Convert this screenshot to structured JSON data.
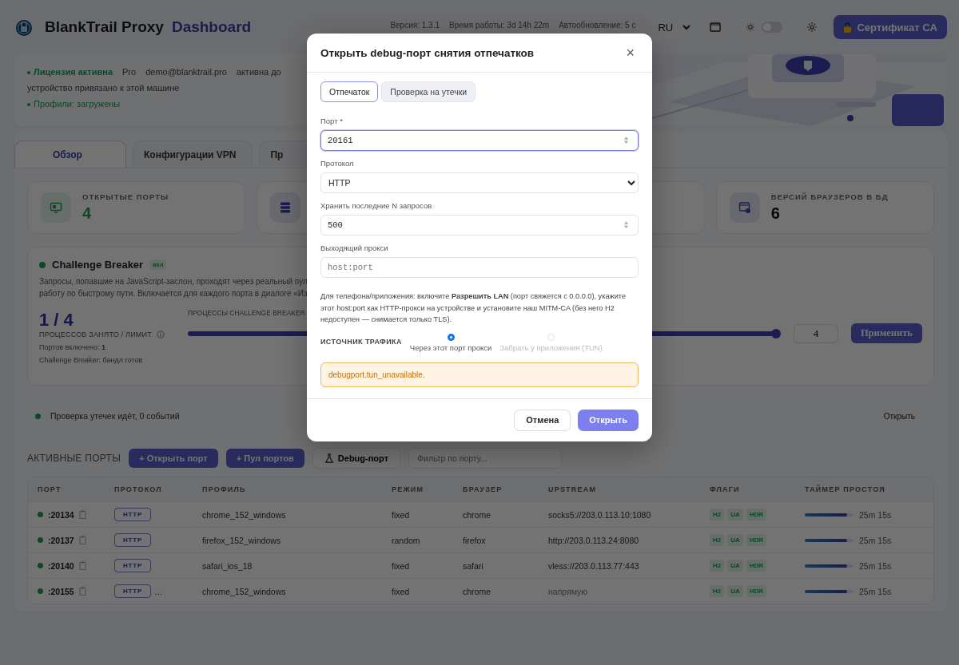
{
  "header": {
    "logo_text": "BlankTrail Proxy",
    "subtitle": "Dashboard",
    "version": "Версия: 1.3.1",
    "uptime": "Время работы: 3d 14h 22m",
    "autorefresh": "Автообновление: 5 с",
    "language": "RU",
    "dark_theme": false,
    "cert_button": "Сертификат CA"
  },
  "license": {
    "status": "Лицензия активна",
    "plan": "Pro",
    "email": "demo@blanktrail.pro",
    "expires": "активна до",
    "device": "устройство привязано к этой машине",
    "profiles": "Профили: загружены"
  },
  "tabs": [
    {
      "label": "Обзор",
      "selected": true
    },
    {
      "label": "Конфигурации VPN",
      "selected": false
    },
    {
      "label": "Пр",
      "selected": false
    }
  ],
  "stats": [
    {
      "kind": "ports",
      "label": "ОТКРЫТЫЕ ПОРТЫ",
      "value": "4"
    },
    {
      "kind": "pool"
    },
    {
      "kind": "hidden"
    },
    {
      "kind": "browsers",
      "label": "ВЕРСИЙ БРАУЗЕРОВ В БД",
      "value": "6"
    }
  ],
  "challenge": {
    "title": "Challenge Breaker",
    "enabled": true,
    "badge": "вкл",
    "description": [
      "Запросы, попавшие на JavaScript-заслон, проходят через реальный пул",
      "работу по быстрому пути. Включается для каждого порта в диалоге «Из"
    ],
    "ratio": "1 / 4",
    "ratio_label": "ПРОЦЕССОВ ЗАНЯТО / ЛИМИТ",
    "ports_enabled": "Портов включено: **1**",
    "status": "Challenge Breaker: бандл готов",
    "slider_label": "ПРОЦЕССЫ CHALLENGE BREAKER",
    "level": 1,
    "limit": "4",
    "apply": "Применить"
  },
  "leak": {
    "active": true,
    "text": "Проверка утечек идёт, 0 событий",
    "action": "Открыть"
  },
  "ports": {
    "title": "АКТИВНЫЕ ПОРТЫ",
    "buttons": [
      "+ Открыть порт",
      "+ Пул портов"
    ],
    "debug_button": "Debug-порт",
    "filter_placeholder": "Фильтр по порту...",
    "columns": [
      "ПОРТ",
      "ПРОТОКОЛ",
      "ПРОФИЛЬ",
      "РЕЖИМ",
      "БРАУЗЕР",
      "UPSTREAM",
      "ФЛАГИ",
      "ТАЙМЕР ПРОСТОЯ"
    ],
    "rows": [
      {
        "active": true,
        "port": ":20134",
        "protocol": "HTTP",
        "profile": "chrome_152_windows",
        "mode": "fixed",
        "browser": "chrome",
        "upstream": "socks5://203.0.113.10:1080",
        "direct": false,
        "flags": [
          "H2",
          "UA",
          "HDR"
        ],
        "level": 0.88,
        "idle": "25m 15s"
      },
      {
        "active": true,
        "port": ":20137",
        "protocol": "HTTP",
        "profile": "firefox_152_windows",
        "mode": "random",
        "browser": "firefox",
        "upstream": "http://203.0.113.24:8080",
        "direct": false,
        "flags": [
          "H2",
          "UA",
          "HDR"
        ],
        "level": 0.88,
        "idle": "25m 15s"
      },
      {
        "active": true,
        "port": ":20140",
        "protocol": "HTTP",
        "profile": "safari_ios_18",
        "mode": "fixed",
        "browser": "safari",
        "upstream": "vless://203.0.113.77:443",
        "direct": false,
        "flags": [
          "H2",
          "UA",
          "HDR"
        ],
        "level": 0.88,
        "idle": "25m 15s"
      },
      {
        "active": true,
        "port": ":20155",
        "protocol": "HTTP",
        "note": "…",
        "profile": "chrome_152_windows",
        "mode": "fixed",
        "browser": "chrome",
        "upstream": "напрямую",
        "direct": true,
        "flags": [
          "H2",
          "UA",
          "HDR"
        ],
        "level": 0.88,
        "idle": "25m 15s"
      }
    ]
  },
  "modal": {
    "title": "Открыть debug-порт снятия отпечатков",
    "close": "×",
    "tabs": [
      {
        "label": "Отпечаток",
        "selected": true
      },
      {
        "label": "Проверка на утечки",
        "selected": false
      }
    ],
    "fields": [
      {
        "kind": "number",
        "label": "Порт *",
        "value": "20161",
        "focused": true
      },
      {
        "kind": "select",
        "label": "Протокол",
        "value": "HTTP",
        "focused": false
      },
      {
        "kind": "number",
        "label": "Хранить последние N запросов",
        "value": "500",
        "focused": false
      },
      {
        "kind": "text",
        "label": "Выходящий прокси",
        "placeholder": "host:port",
        "focused": false
      }
    ],
    "help": "Для телефона/приложения: включите **Разрешить LAN** (порт свяжется с 0.0.0.0), укажите этот host:port как HTTP-прокси на устройстве и установите наш MITM-CA (без него H2 недоступен — снимается только TLS).",
    "source_label": "ИСТОЧНИК ТРАФИКА",
    "sources": [
      {
        "label": "Через этот порт прокси",
        "selected": true,
        "disabled": false
      },
      {
        "label": "Забрать у приложения (TUN)",
        "selected": false,
        "disabled": true
      }
    ],
    "warning": "debugport.tun_unavailable.",
    "cancel": "Отмена",
    "submit": "Открыть"
  }
}
